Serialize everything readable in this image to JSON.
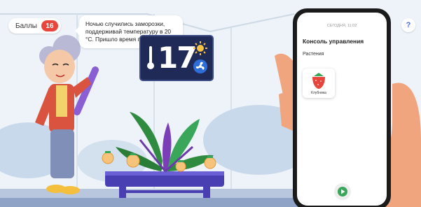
{
  "score": {
    "label": "Баллы",
    "value": "16"
  },
  "speech": {
    "text": "Ночью случились заморозки, поддерживай температуру в 20 °С. Пришло время полива!"
  },
  "display": {
    "temperature": "17",
    "sun_icon": "sun-icon",
    "fan_icon": "fan-icon",
    "thermo_icon": "thermometer-icon"
  },
  "help": {
    "label": "?"
  },
  "phone": {
    "status": "СЕГОДНЯ, 11:02",
    "title": "Консоль управления",
    "section": "Растения",
    "plants": [
      {
        "name": "Клубника",
        "icon": "strawberry-icon"
      }
    ],
    "play_icon": "play-icon"
  },
  "colors": {
    "accent": "#e8463c",
    "display_bg": "#1f2a56",
    "play_green": "#3aa65a",
    "greenhouse_frame": "#8a5fd4"
  }
}
